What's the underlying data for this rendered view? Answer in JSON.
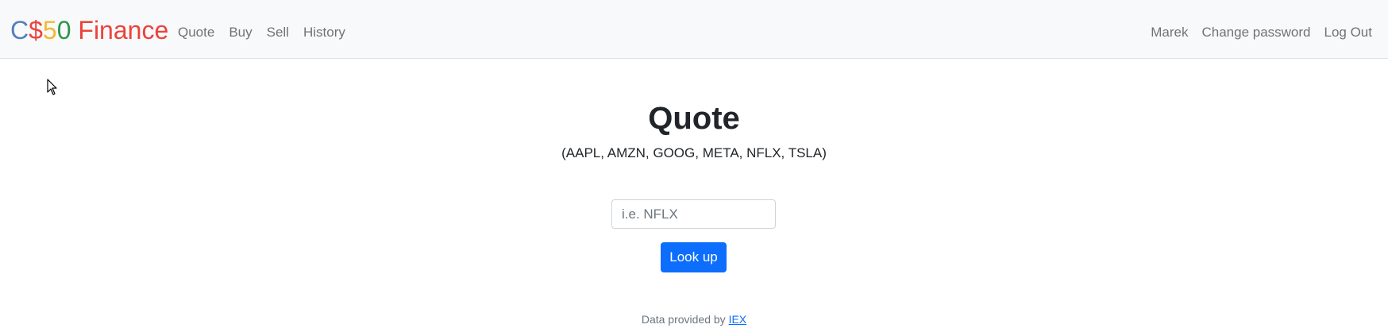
{
  "brand": {
    "parts": [
      {
        "text": "C",
        "color": "#537fbe"
      },
      {
        "text": "$",
        "color": "#ea433b"
      },
      {
        "text": "5",
        "color": "#f5b82e"
      },
      {
        "text": "0",
        "color": "#2e944b"
      },
      {
        "text": " Finance",
        "color": "#ea433b"
      }
    ]
  },
  "nav": {
    "left": [
      "Quote",
      "Buy",
      "Sell",
      "History"
    ],
    "right": [
      "Marek",
      "Change password",
      "Log Out"
    ]
  },
  "main": {
    "title": "Quote",
    "subtitle": "(AAPL, AMZN, GOOG, META, NFLX, TSLA)",
    "input": {
      "placeholder": "i.e. NFLX",
      "value": ""
    },
    "button_label": "Look up"
  },
  "footer": {
    "text": "Data provided by ",
    "link_text": "IEX"
  },
  "colors": {
    "navbar_bg": "#f8f9fa",
    "primary": "#0d6efd"
  }
}
